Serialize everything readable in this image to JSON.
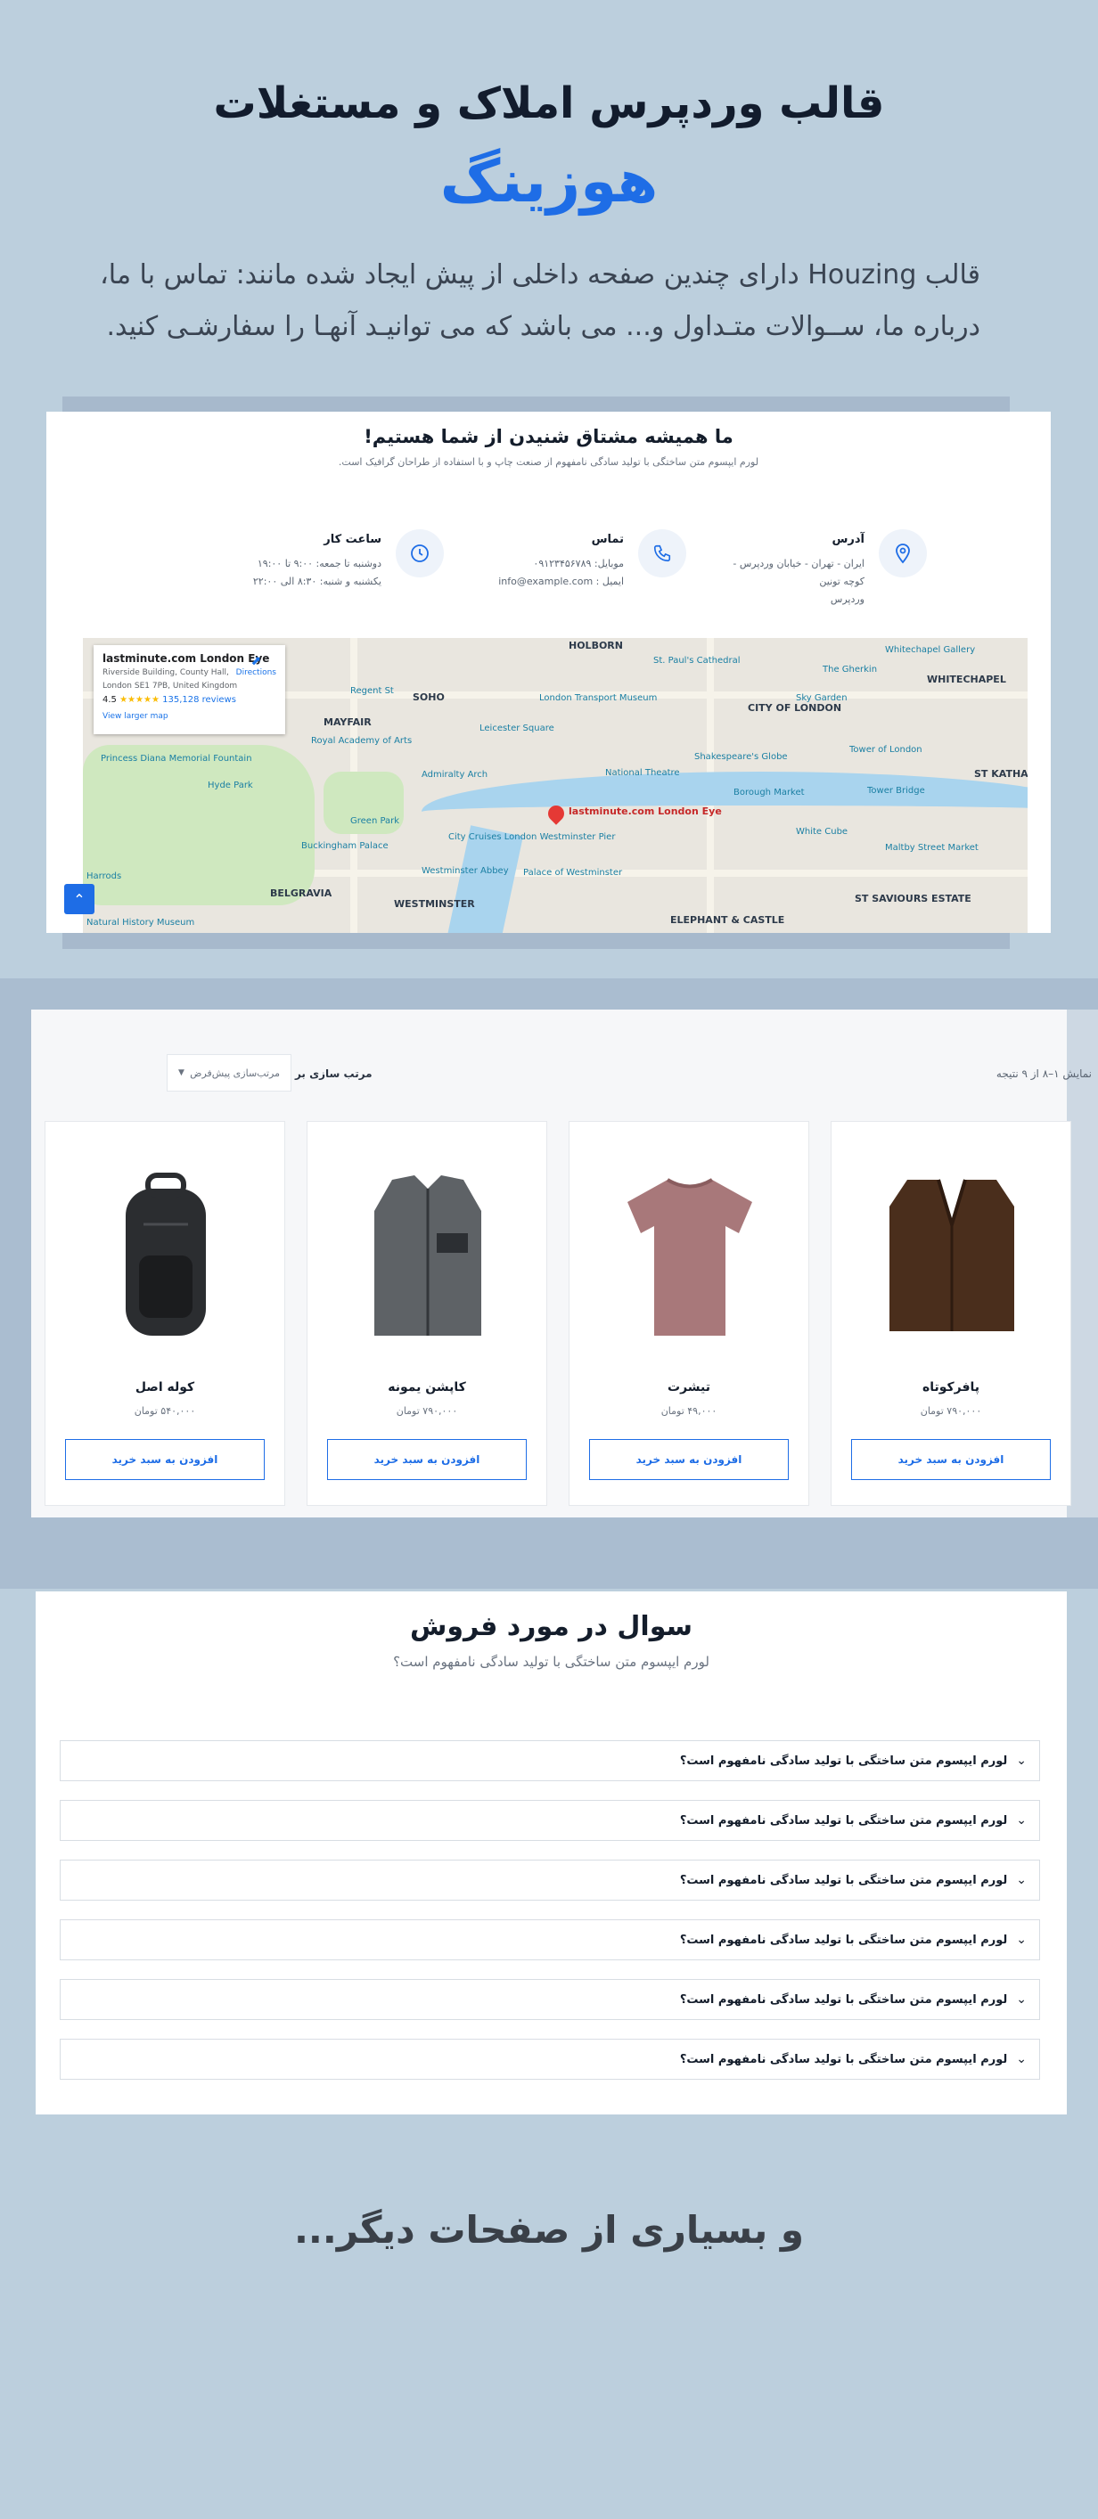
{
  "hero": {
    "title": "قالب وردپرس املاک و مستغلات",
    "brand": "هوزینگ",
    "description": "قالب Houzing دارای چندین صفحه داخلی از پیش ایجاد شده مانند: تماس با ما، درباره ما، ســوالات متـداول و... می باشد که می توانیـد آنهـا را سفارشـی کنید."
  },
  "contact": {
    "title": "ما همیشه مشتاق شنیدن از شما هستیم!",
    "subtitle": "لورم ایپسوم متن ساختگی با تولید سادگی نامفهوم از صنعت چاپ و با استفاده از طراحان گرافیک است.",
    "address": {
      "heading": "آدرس",
      "lines": [
        "ایران - تهران - خیابان وردپرس - کوچه تونین",
        "وردپرس"
      ],
      "icon": "location-pin-icon"
    },
    "phone": {
      "heading": "تماس",
      "lines": [
        "موبایل: ۰۹۱۲۳۴۵۶۷۸۹",
        "ایمیل : info@example.com"
      ],
      "icon": "phone-icon"
    },
    "hours": {
      "heading": "ساعت کار",
      "lines": [
        "دوشنبه تا جمعه: ۹:۰۰ تا ۱۹:۰۰",
        "یکشنبه و شنبه: ۸:۳۰ الی ۲۲:۰۰"
      ],
      "icon": "clock-icon"
    }
  },
  "map": {
    "place_name": "lastminute.com London Eye",
    "address_line1": "Riverside Building, County Hall,",
    "address_line2": "London SE1 7PB, United Kingdom",
    "rating": "4.5",
    "stars": "★★★★★",
    "reviews": "135,128 reviews",
    "larger_map": "View larger map",
    "directions": "Directions",
    "pin_label": "lastminute.com London Eye",
    "labels": {
      "holborn": "HOLBORN",
      "soho": "SOHO",
      "mayfair": "MAYFAIR",
      "city": "CITY OF LONDON",
      "whitechapel": "WHITECHAPEL",
      "westminster": "WESTMINSTER",
      "belgravia": "BELGRAVIA",
      "elephant": "ELEPHANT & CASTLE",
      "stkath": "ST KATHARINE'S & WAPPING",
      "stsav": "ST SAVIOURS ESTATE"
    },
    "pois": {
      "stpauls": "St. Paul's Cathedral",
      "ltm": "London Transport Museum",
      "regents": "Regent St",
      "leicester": "Leicester Square",
      "royalacademy": "Royal Academy of Arts",
      "skygarden": "Sky Garden",
      "toweroflondon": "Tower of London",
      "globe": "Shakespeare's Globe",
      "natheatre": "National Theatre",
      "borough": "Borough Market",
      "towerbridge": "Tower Bridge",
      "buckingham": "Buckingham Palace",
      "admiralty": "Admiralty Arch",
      "cityCruises": "City Cruises London Westminster Pier",
      "westminsterAbbey": "Westminster Abbey",
      "palace": "Palace of Westminster",
      "hydepark": "Hyde Park",
      "diana": "Princess Diana Memorial Fountain",
      "harrods": "Harrods",
      "nhm": "Natural History Museum",
      "greenpark": "Green Park",
      "whitechapelGallery": "Whitechapel Gallery",
      "gherkin": "The Gherkin",
      "whiteCube": "White Cube",
      "maltby": "Maltby Street Market"
    }
  },
  "shop": {
    "result_count": "نمایش ۱–۸ از ۹ نتیجه",
    "sort_label": "مرتب سازی بر اساس:",
    "sort_value": "مرتب‌سازی پیش‌فرض",
    "add_to_cart": "افزودن به سبد خرید",
    "products": [
      {
        "name": "کوله اصل",
        "price": "۵۴۰,۰۰۰ تومان",
        "image": "backpack"
      },
      {
        "name": "کاپشن یمونه",
        "price": "۷۹۰,۰۰۰ تومان",
        "image": "vest-gray"
      },
      {
        "name": "تیشرت",
        "price": "۴۹,۰۰۰ تومان",
        "image": "tshirt"
      },
      {
        "name": "پافرکوتاه",
        "price": "۷۹۰,۰۰۰ تومان",
        "image": "vest-brown"
      }
    ]
  },
  "faq": {
    "title": "سوال در مورد فروش",
    "subtitle": "لورم ایپسوم متن ساختگی با تولید سادگی نامفهوم است؟",
    "items": [
      "لورم ایپسوم متن ساختگی با تولید سادگی نامفهوم است؟",
      "لورم ایپسوم متن ساختگی با تولید سادگی نامفهوم است؟",
      "لورم ایپسوم متن ساختگی با تولید سادگی نامفهوم است؟",
      "لورم ایپسوم متن ساختگی با تولید سادگی نامفهوم است؟",
      "لورم ایپسوم متن ساختگی با تولید سادگی نامفهوم است؟",
      "لورم ایپسوم متن ساختگی با تولید سادگی نامفهوم است؟"
    ]
  },
  "footer": {
    "more": "و بسیاری از صفحات دیگر..."
  },
  "colors": {
    "page_bg": "#bccfdd",
    "accent": "#1e6de6",
    "heading": "#121c2d"
  }
}
